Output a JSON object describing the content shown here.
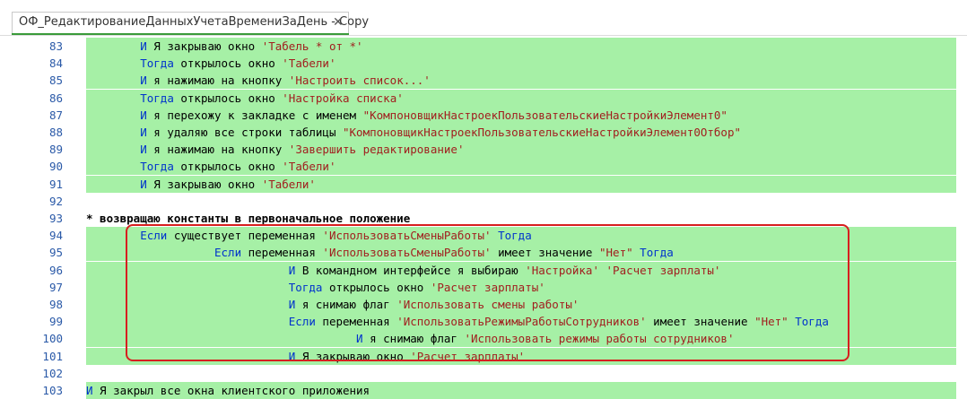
{
  "tab": {
    "title": "ОФ_РедактированиеДанныхУчетаВремениЗаДень - Copy",
    "close": "✕"
  },
  "lines": [
    {
      "n": "83",
      "indent": "        ",
      "hl": true,
      "parts": [
        [
          "I",
          "И Я закрываю окно "
        ],
        [
          "S",
          "'Табель * от *'"
        ]
      ]
    },
    {
      "n": "84",
      "indent": "        ",
      "hl": true,
      "parts": [
        [
          "K",
          "Тогда"
        ],
        [
          "T",
          " открылось окно "
        ],
        [
          "S",
          "'Табели'"
        ]
      ]
    },
    {
      "n": "85",
      "indent": "        ",
      "hl": true,
      "parts": [
        [
          "I",
          "И я нажимаю на кнопку "
        ],
        [
          "S",
          "'Настроить список...'"
        ]
      ]
    },
    {
      "n": "86",
      "indent": "        ",
      "hl": true,
      "parts": [
        [
          "K",
          "Тогда"
        ],
        [
          "T",
          " открылось окно "
        ],
        [
          "S",
          "'Настройка списка'"
        ]
      ]
    },
    {
      "n": "87",
      "indent": "        ",
      "hl": true,
      "parts": [
        [
          "I",
          "И я перехожу к закладке с именем "
        ],
        [
          "S",
          "\"КомпоновщикНастроекПользовательскиеНастройкиЭлемент0\""
        ]
      ]
    },
    {
      "n": "88",
      "indent": "        ",
      "hl": true,
      "parts": [
        [
          "I",
          "И я удаляю все строки таблицы "
        ],
        [
          "S",
          "\"КомпоновщикНастроекПользовательскиеНастройкиЭлемент0Отбор\""
        ]
      ]
    },
    {
      "n": "89",
      "indent": "        ",
      "hl": true,
      "parts": [
        [
          "I",
          "И я нажимаю на кнопку "
        ],
        [
          "S",
          "'Завершить редактирование'"
        ]
      ]
    },
    {
      "n": "90",
      "indent": "        ",
      "hl": true,
      "parts": [
        [
          "K",
          "Тогда"
        ],
        [
          "T",
          " открылось окно "
        ],
        [
          "S",
          "'Табели'"
        ]
      ]
    },
    {
      "n": "91",
      "indent": "        ",
      "hl": true,
      "parts": [
        [
          "I",
          "И Я закрываю окно "
        ],
        [
          "S",
          "'Табели'"
        ]
      ]
    },
    {
      "n": "92",
      "indent": "",
      "hl": false,
      "parts": []
    },
    {
      "n": "93",
      "indent": "",
      "hl": false,
      "note": true,
      "parts": [
        [
          "T",
          "* возвращаю константы в первоначальное положение"
        ]
      ]
    },
    {
      "n": "94",
      "indent": "        ",
      "hl": true,
      "parts": [
        [
          "K",
          "Если"
        ],
        [
          "T",
          " существует переменная "
        ],
        [
          "S",
          "'ИспользоватьСменыРаботы'"
        ],
        [
          "T",
          " "
        ],
        [
          "K",
          "Тогда"
        ]
      ]
    },
    {
      "n": "95",
      "indent": "                   ",
      "hl": true,
      "parts": [
        [
          "K",
          "Если"
        ],
        [
          "T",
          " переменная "
        ],
        [
          "S",
          "'ИспользоватьСменыРаботы'"
        ],
        [
          "T",
          " имеет значение "
        ],
        [
          "S",
          "\"Нет\""
        ],
        [
          "T",
          " "
        ],
        [
          "K",
          "Тогда"
        ]
      ]
    },
    {
      "n": "96",
      "indent": "                              ",
      "hl": true,
      "parts": [
        [
          "I",
          "И В командном интерфейсе я выбираю "
        ],
        [
          "S",
          "'Настройка'"
        ],
        [
          "T",
          " "
        ],
        [
          "S",
          "'Расчет зарплаты'"
        ]
      ]
    },
    {
      "n": "97",
      "indent": "                              ",
      "hl": true,
      "parts": [
        [
          "K",
          "Тогда"
        ],
        [
          "T",
          " открылось окно "
        ],
        [
          "S",
          "'Расчет зарплаты'"
        ]
      ]
    },
    {
      "n": "98",
      "indent": "                              ",
      "hl": true,
      "parts": [
        [
          "I",
          "И я снимаю флаг "
        ],
        [
          "S",
          "'Использовать смены работы'"
        ]
      ]
    },
    {
      "n": "99",
      "indent": "                              ",
      "hl": true,
      "parts": [
        [
          "K",
          "Если"
        ],
        [
          "T",
          " переменная "
        ],
        [
          "S",
          "'ИспользоватьРежимыРаботыСотрудников'"
        ],
        [
          "T",
          " имеет значение "
        ],
        [
          "S",
          "\"Нет\""
        ],
        [
          "T",
          " "
        ],
        [
          "K",
          "Тогда"
        ]
      ]
    },
    {
      "n": "100",
      "indent": "                                        ",
      "hl": true,
      "parts": [
        [
          "I",
          "И я снимаю флаг "
        ],
        [
          "S",
          "'Использовать режимы работы сотрудников'"
        ]
      ]
    },
    {
      "n": "101",
      "indent": "                              ",
      "hl": true,
      "parts": [
        [
          "I",
          "И Я закрываю окно "
        ],
        [
          "S",
          "'Расчет зарплаты'"
        ]
      ]
    },
    {
      "n": "102",
      "indent": "",
      "hl": false,
      "parts": []
    },
    {
      "n": "103",
      "indent": "",
      "hl": true,
      "parts": [
        [
          "I",
          "И Я закрыл все окна клиентского приложения"
        ]
      ]
    }
  ],
  "colors": {
    "highlight": "#a6f0a6",
    "keyword": "#0033cc",
    "string": "#a11f1f",
    "box": "#d71f1f"
  }
}
